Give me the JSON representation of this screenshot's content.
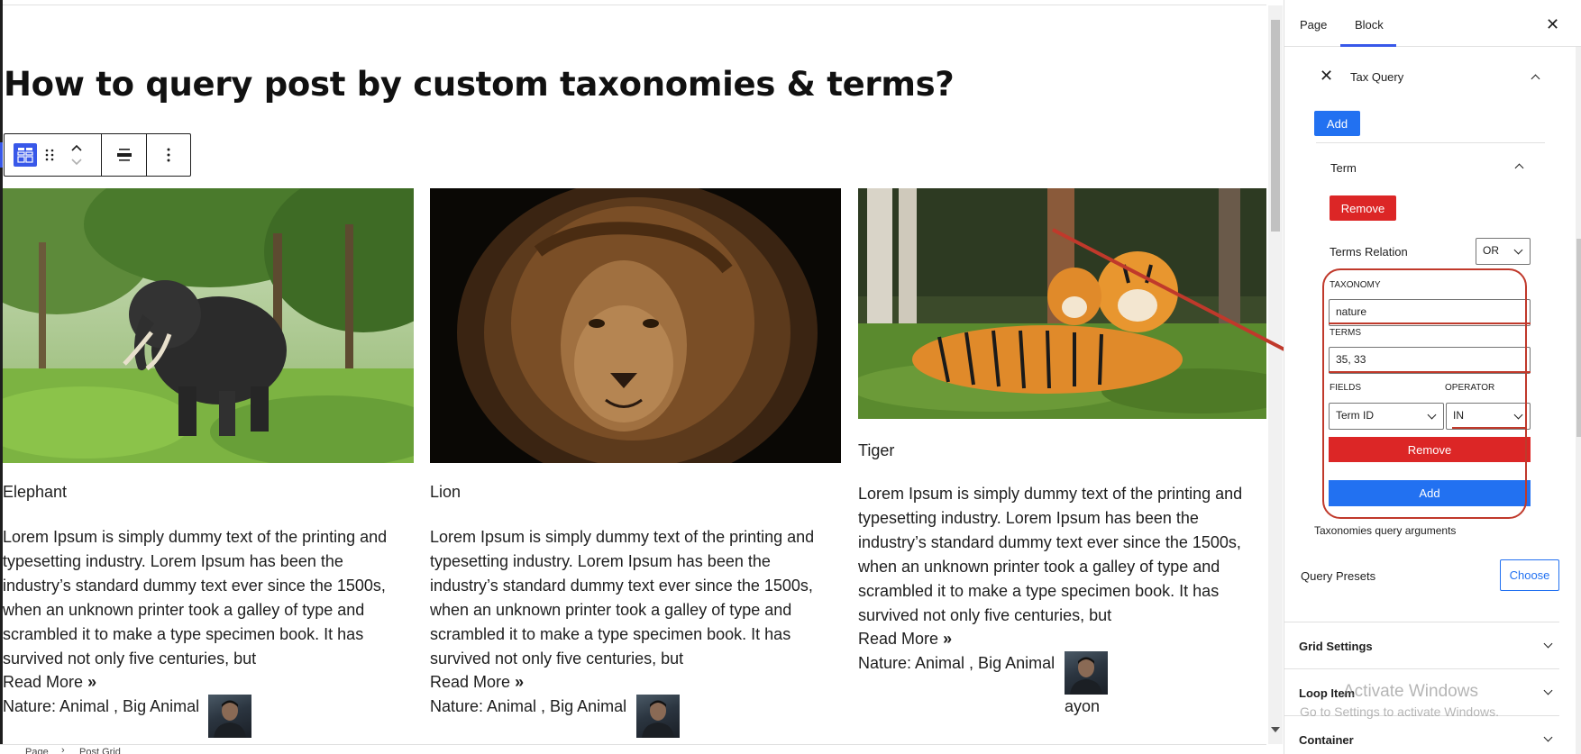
{
  "post": {
    "title": "How to query post by custom taxonomies & terms?"
  },
  "toolbar": {
    "block_icon": "post-grid-icon",
    "drag_icon": "drag-handle-icon",
    "mover_icon": "move-up-down-icon",
    "align_icon": "align-icon",
    "more_icon": "more-options-icon"
  },
  "posts": [
    {
      "image": "elephant",
      "title": "Elephant",
      "excerpt_lines": [
        "Lorem Ipsum is simply dummy text of the printing and",
        "typesetting industry. Lorem Ipsum has been the",
        "industry’s standard dummy text ever since the 1500s,",
        "when an unknown printer took a galley of type and",
        "scrambled it to make a type specimen book. It has",
        "survived not only five centuries, but"
      ],
      "read_more": "Read More",
      "taxonomy_line": "Nature: Animal , Big Animal",
      "author": ""
    },
    {
      "image": "lion",
      "title": "Lion",
      "excerpt_lines": [
        "Lorem Ipsum is simply dummy text of the printing and",
        "typesetting industry. Lorem Ipsum has been the",
        "industry’s standard dummy text ever since the 1500s,",
        "when an unknown printer took a galley of type and",
        "scrambled it to make a type specimen book. It has",
        "survived not only five centuries, but"
      ],
      "read_more": "Read More",
      "taxonomy_line": "Nature: Animal , Big Animal",
      "author": ""
    },
    {
      "image": "tiger",
      "title": "Tiger",
      "excerpt_lines": [
        "Lorem Ipsum is simply dummy text of the printing and",
        "typesetting industry. Lorem Ipsum has been the",
        "industry’s standard dummy text ever since the 1500s,",
        "when an unknown printer took a galley of type and",
        "scrambled it to make a type specimen book. It has",
        "survived not only five centuries, but"
      ],
      "read_more": "Read More",
      "taxonomy_line": "Nature: Animal , Big Animal",
      "author": "ayon"
    }
  ],
  "breadcrumb": {
    "items": [
      "Page",
      "Post Grid"
    ]
  },
  "sidebar": {
    "tabs": [
      "Page",
      "Block"
    ],
    "active_tab": "Block",
    "tax_query": {
      "label": "Tax Query",
      "add_label": "Add",
      "term_label": "Term",
      "remove_label": "Remove",
      "terms_relation_label": "Terms Relation",
      "terms_relation_value": "OR",
      "taxonomy_label": "TAXONOMY",
      "taxonomy_value": "nature",
      "terms_label": "TERMS",
      "terms_value": "35, 33",
      "fields_label": "FIELDS",
      "fields_value": "Term ID",
      "operator_label": "OPERATOR",
      "operator_value": "IN",
      "inner_remove_label": "Remove",
      "inner_add_label": "Add",
      "help_text": "Taxonomies query arguments"
    },
    "query_presets": {
      "label": "Query Presets",
      "choose_label": "Choose"
    },
    "sections": [
      "Grid Settings",
      "Loop Item",
      "Container"
    ]
  },
  "watermark": {
    "title": "Activate Windows",
    "subtitle": "Go to Settings to activate Windows."
  },
  "colors": {
    "accent": "#2271f1",
    "wp_blue": "#3858e9",
    "danger": "#dc2626",
    "annotation": "#c0392b"
  }
}
